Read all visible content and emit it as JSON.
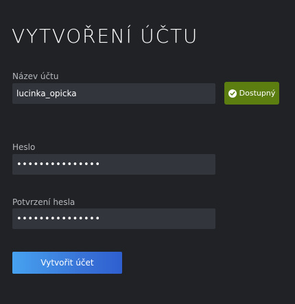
{
  "page": {
    "title": "VYTVOŘENÍ ÚČTU"
  },
  "account": {
    "label": "Název účtu",
    "value": "lucinka_opicka",
    "availability": {
      "label": "Dostupný",
      "icon": "checkmark-circle-icon",
      "color": "#5c7e10"
    }
  },
  "password": {
    "label": "Heslo",
    "value": "•••••••••••••••"
  },
  "password_confirm": {
    "label": "Potvrzení hesla",
    "value": "•••••••••••••••"
  },
  "submit": {
    "label": "Vytvořit účet",
    "color_start": "#47a2f0",
    "color_end": "#2f5fd0"
  },
  "theme": {
    "background": "#202226",
    "field_background": "#32353c"
  }
}
